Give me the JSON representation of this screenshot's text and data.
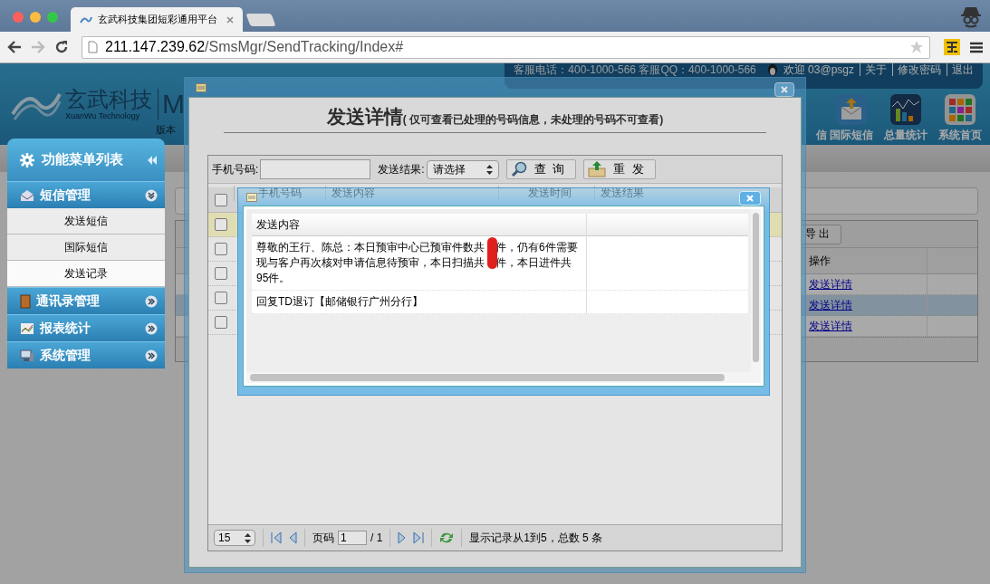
{
  "browser": {
    "tab_title": "玄武科技集团短彩通用平台",
    "url_host": "211.147.239.62",
    "url_path": "/SmsMgr/SendTracking/Index#"
  },
  "header": {
    "logo_cn": "玄武科技",
    "logo_en": "XuanWu Technology",
    "logo_mark": "M",
    "version": "版本",
    "service": "客服电话：400-1000-566  客服QQ：400-1000-566",
    "welcome": "欢迎 03@psgz",
    "links": [
      "关于",
      "修改密码",
      "退出"
    ],
    "nav": [
      {
        "label": "信"
      },
      {
        "label": "国际短信",
        "kind": "mail"
      },
      {
        "label": "总量统计",
        "kind": "chart"
      },
      {
        "label": "系统首页",
        "kind": "grid"
      }
    ]
  },
  "sidebar": {
    "title": "功能菜单列表",
    "groups": [
      {
        "label": "短信管理",
        "kind": "mail",
        "expanded": true,
        "children": [
          {
            "label": "发送短信",
            "selected": false
          },
          {
            "label": "国际短信",
            "selected": false
          },
          {
            "label": "发送记录",
            "selected": true
          }
        ]
      },
      {
        "label": "通讯录管理",
        "kind": "book",
        "expanded": false
      },
      {
        "label": "报表统计",
        "kind": "chart",
        "expanded": false
      },
      {
        "label": "系统管理",
        "kind": "monitor",
        "expanded": false
      }
    ]
  },
  "records": {
    "export_button": "导 出",
    "column": "操作",
    "rows": [
      {
        "link": "发送详情",
        "selected": false
      },
      {
        "link": "发送详情",
        "selected": true
      },
      {
        "link": "发送详情",
        "selected": false
      }
    ]
  },
  "detail_dialog": {
    "heading": "发送详情",
    "note": "( 仅可查看已处理的号码信息，未处理的号码不可查看)",
    "phone_label": "手机号码:",
    "result_label": "发送结果:",
    "result_value": "请选择",
    "buttons": [
      {
        "label": "查 询",
        "kind": "search"
      },
      {
        "label": "重 发",
        "kind": "resend"
      }
    ],
    "all_checked": false,
    "columns": [
      "手机号码",
      "发送内容",
      "发送时间",
      "发送结果"
    ],
    "rows": [
      {
        "checked": false,
        "selected": true
      },
      {
        "checked": false,
        "selected": false
      },
      {
        "checked": false,
        "selected": false
      },
      {
        "checked": false,
        "selected": false
      },
      {
        "checked": false,
        "selected": false
      }
    ],
    "pager": {
      "page_size": "15",
      "page_label": "页码",
      "page": "1",
      "total_pages": "/ 1",
      "summary": "显示记录从1到5，总数 5 条"
    }
  },
  "content_dialog": {
    "columns": [
      "发送内容"
    ],
    "rows": [
      {
        "content": "尊敬的王行、陈总：本日预审中心已预审件数共　件，仍有6件需要现与客户再次核对申请信息待预审，本日扫描共　件，本日进件共95件。",
        "redacted": true
      },
      {
        "content": "回复TD退订【邮储银行广州分行】",
        "redacted": false
      }
    ]
  }
}
